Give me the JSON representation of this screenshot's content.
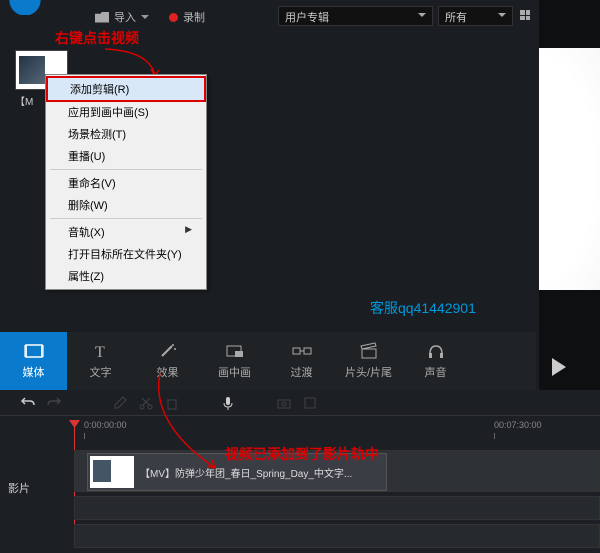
{
  "toolbar": {
    "import_label": "导入",
    "record_label": "录制"
  },
  "dropdowns": {
    "collection": "用户专辑",
    "filter": "所有"
  },
  "annotations": {
    "right_click_hint": "右键点击视频",
    "added_hint": "视频已添加到了影片轨中",
    "watermark": "客服qq41442901"
  },
  "thumbnail": {
    "label_truncated": "【M"
  },
  "context_menu": {
    "add_cut": "添加剪辑(R)",
    "apply_pip": "应用到画中画(S)",
    "scene_detect": "场景检测(T)",
    "replay": "重播(U)",
    "rename": "重命名(V)",
    "delete": "删除(W)",
    "audio_track": "音轨(X)",
    "open_folder": "打开目标所在文件夹(Y)",
    "properties": "属性(Z)"
  },
  "tabs": {
    "media": "媒体",
    "text": "文字",
    "effect": "效果",
    "pip": "画中画",
    "transition": "过渡",
    "intro": "片头/片尾",
    "sound": "声音"
  },
  "timeline": {
    "start_time": "0:00:00:00",
    "end_time": "00:07:30:00",
    "track_label": "影片",
    "clip_name": "【MV】防弹少年团_春日_Spring_Day_中文字..."
  }
}
